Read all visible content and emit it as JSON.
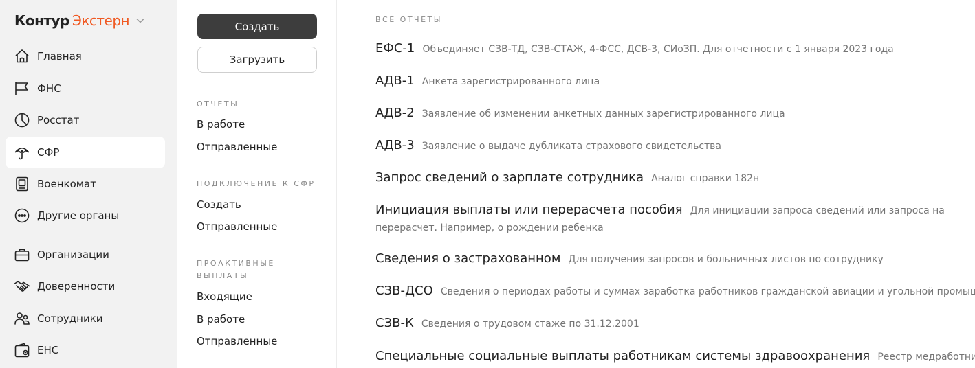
{
  "app": {
    "logo_part1": "Контур",
    "logo_part2": "Экстерн",
    "accent_color": "#f05a23"
  },
  "sidebar": {
    "items": [
      {
        "label": "Главная",
        "icon": "home-icon",
        "active": false
      },
      {
        "label": "ФНС",
        "icon": "flag-icon",
        "active": false
      },
      {
        "label": "Росстат",
        "icon": "pie-chart-icon",
        "active": false
      },
      {
        "label": "СФР",
        "icon": "umbrella-icon",
        "active": true
      },
      {
        "label": "Военкомат",
        "icon": "id-card-icon",
        "active": false
      },
      {
        "label": "Другие органы",
        "icon": "more-circle-icon",
        "active": false
      },
      {
        "label": "Организации",
        "icon": "briefcase-icon",
        "active": false
      },
      {
        "label": "Доверенности",
        "icon": "handshake-icon",
        "active": false
      },
      {
        "label": "Сотрудники",
        "icon": "users-icon",
        "active": false
      },
      {
        "label": "ЕНС",
        "icon": "wallet-icon",
        "active": false
      }
    ]
  },
  "midcol": {
    "create_label": "Создать",
    "upload_label": "Загрузить",
    "sections": [
      {
        "title": "ОТЧЕТЫ",
        "links": [
          "В работе",
          "Отправленные"
        ]
      },
      {
        "title": "ПОДКЛЮЧЕНИЕ К СФР",
        "links": [
          "Создать",
          "Отправленные"
        ]
      },
      {
        "title": "ПРОАКТИВНЫЕ ВЫПЛАТЫ",
        "links": [
          "Входящие",
          "В работе",
          "Отправленные"
        ]
      }
    ]
  },
  "reports": {
    "heading": "ВСЕ ОТЧЕТЫ",
    "items": [
      {
        "name": "ЕФС-1",
        "desc": "Объединяет СЗВ-ТД, СЗВ-СТАЖ, 4-ФСС, ДСВ-3, СИоЗП. Для отчетности с 1 января 2023 года"
      },
      {
        "name": "АДВ-1",
        "desc": "Анкета зарегистрированного лица"
      },
      {
        "name": "АДВ-2",
        "desc": "Заявление об изменении анкетных данных зарегистрированного лица"
      },
      {
        "name": "АДВ-3",
        "desc": "Заявление о выдаче дубликата страхового свидетельства"
      },
      {
        "name": "Запрос сведений о зарплате сотрудника",
        "desc": "Аналог справки 182н"
      },
      {
        "name": "Инициация выплаты или перерасчета пособия",
        "desc": "Для инициации запроса сведений или запроса на перерасчет. Например, о рождении ребенка"
      },
      {
        "name": "Сведения о застрахованном",
        "desc": "Для получения запросов и больничных листов по сотруднику"
      },
      {
        "name": "СЗВ-ДСО",
        "desc": "Сведения о периодах работы и суммах заработка работников гражданской авиации и угольной промышленности"
      },
      {
        "name": "СЗВ-К",
        "desc": "Сведения о трудовом стаже по 31.12.2001"
      },
      {
        "name": "Специальные социальные выплаты работникам системы здравоохранения",
        "desc": "Реестр медработников для назначения выплат"
      }
    ]
  }
}
